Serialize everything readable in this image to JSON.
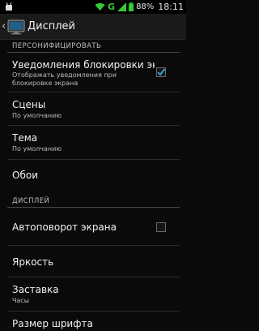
{
  "status_bar": {
    "network_type": "G",
    "battery_percent": "88%",
    "clock": "18:11"
  },
  "action_bar": {
    "title": "Дисплей"
  },
  "sections": {
    "personalize": "ПЕРСОНИФИЦИРОВАТЬ",
    "display": "ДИСПЛЕЙ"
  },
  "items": {
    "lock_notifications": {
      "title": "Уведомления блокировки экр",
      "subtitle_line1": "Отображать уведомления при",
      "subtitle_line2": "блокировке экрана",
      "checked": true
    },
    "scenes": {
      "title": "Сцены",
      "subtitle": "По умолчанию"
    },
    "theme": {
      "title": "Тема",
      "subtitle": "По умолчанию"
    },
    "wallpaper": {
      "title": "Обои"
    },
    "auto_rotate": {
      "title": "Автоповорот экрана",
      "checked": false
    },
    "brightness": {
      "title": "Яркость"
    },
    "screensaver": {
      "title": "Заставка",
      "subtitle": "Часы"
    },
    "font_size": {
      "title": "Размер шрифта"
    }
  },
  "colors": {
    "accent": "#2fa6e0",
    "network": "#33cc33",
    "background": "#0a0a0a"
  }
}
